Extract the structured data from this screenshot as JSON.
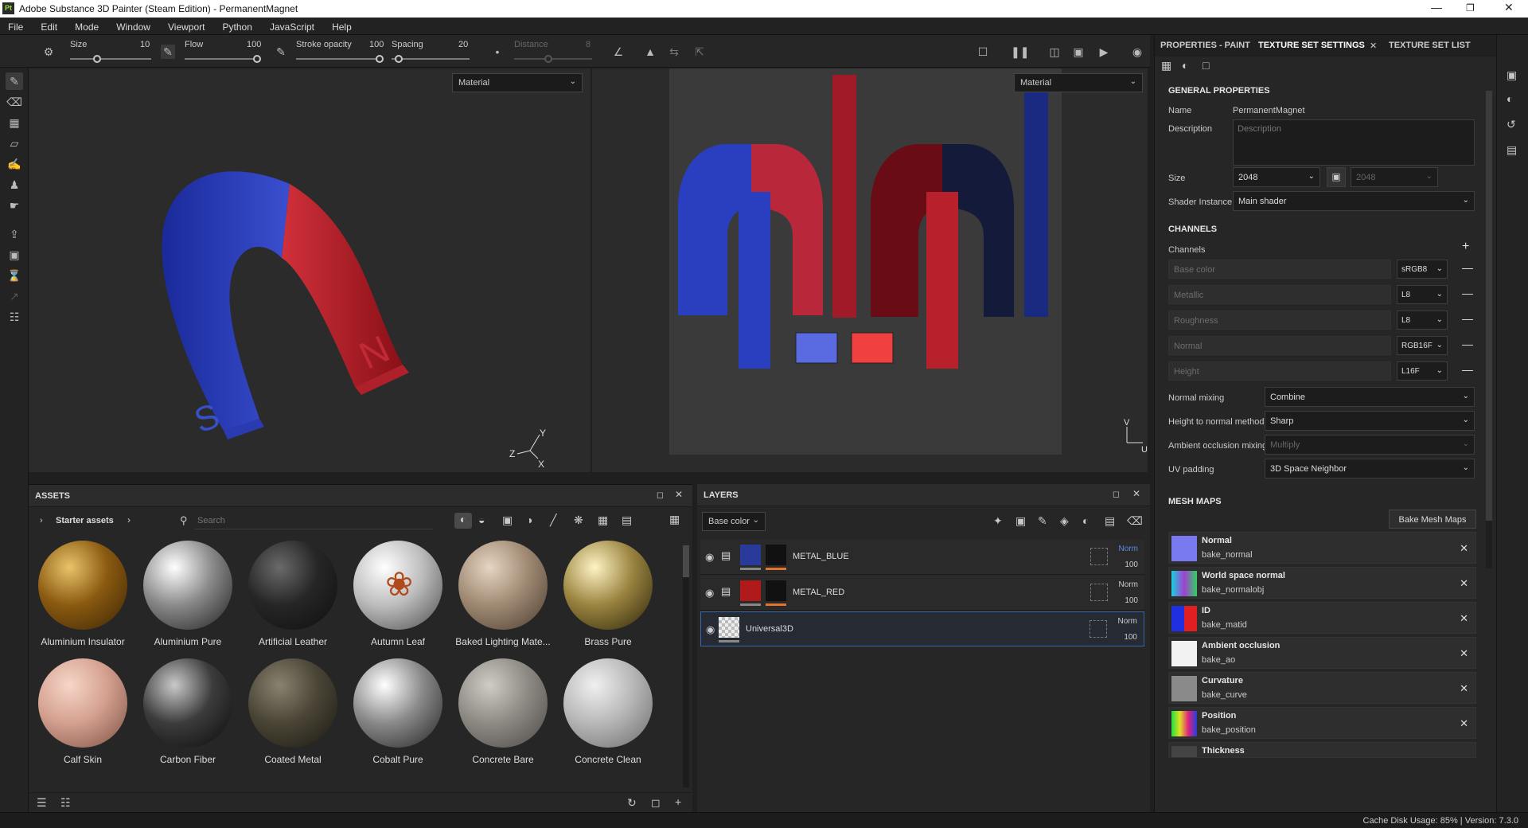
{
  "window": {
    "title": "Adobe Substance 3D Painter (Steam Edition) - PermanentMagnet",
    "app_icon": "Pt"
  },
  "menu": [
    "File",
    "Edit",
    "Mode",
    "Window",
    "Viewport",
    "Python",
    "JavaScript",
    "Help"
  ],
  "toolbar": {
    "size_label": "Size",
    "size_value": "10",
    "flow_label": "Flow",
    "flow_value": "100",
    "stroke_label": "Stroke opacity",
    "stroke_value": "100",
    "spacing_label": "Spacing",
    "spacing_value": "20",
    "distance_label": "Distance",
    "distance_value": "8"
  },
  "viewport3d": {
    "mode": "Material",
    "axis_y": "Y",
    "axis_z": "Z",
    "axis_x": "X",
    "letter_s": "S",
    "letter_n": "N"
  },
  "viewport2d": {
    "mode": "Material",
    "axis_y": "V",
    "axis_x": "U"
  },
  "assets": {
    "title": "ASSETS",
    "breadcrumb": "Starter assets",
    "search_placeholder": "Search",
    "items": [
      {
        "name": "Aluminium Insulator",
        "c1": "#e9c36a",
        "c2": "#8a5a10",
        "c3": "#3a2405"
      },
      {
        "name": "Aluminium Pure",
        "c1": "#ffffff",
        "c2": "#8a8a8a",
        "c3": "#1e1e1e"
      },
      {
        "name": "Artificial Leather",
        "c1": "#6a6a6a",
        "c2": "#262626",
        "c3": "#0e0e0e"
      },
      {
        "name": "Autumn Leaf",
        "c1": "#ffffff",
        "c2": "#bdbdbd",
        "c3": "#4a4a4a"
      },
      {
        "name": "Baked Lighting Mate...",
        "c1": "#e6d5c2",
        "c2": "#a08a74",
        "c3": "#4a3b2e"
      },
      {
        "name": "Brass Pure",
        "c1": "#fff3c4",
        "c2": "#9a8440",
        "c3": "#2a2208"
      },
      {
        "name": "Calf Skin",
        "c1": "#f6d6c8",
        "c2": "#d4a090",
        "c3": "#7a5040"
      },
      {
        "name": "Carbon Fiber",
        "c1": "#c9c9c9",
        "c2": "#3c3c3c",
        "c3": "#0a0a0a"
      },
      {
        "name": "Coated Metal",
        "c1": "#8a8270",
        "c2": "#4a4536",
        "c3": "#1a1812"
      },
      {
        "name": "Cobalt Pure",
        "c1": "#ffffff",
        "c2": "#8a8a8a",
        "c3": "#222222"
      },
      {
        "name": "Concrete Bare",
        "c1": "#cfccc6",
        "c2": "#8e8a84",
        "c3": "#4a4844"
      },
      {
        "name": "Concrete Clean",
        "c1": "#f0f0f0",
        "c2": "#b8b8b8",
        "c3": "#6a6a6a"
      }
    ]
  },
  "layers": {
    "title": "LAYERS",
    "channel": "Base color",
    "rows": [
      {
        "name": "METAL_BLUE",
        "blend": "Norm",
        "opacity": "100",
        "color": "#2a3a9a"
      },
      {
        "name": "METAL_RED",
        "blend": "Norm",
        "opacity": "100",
        "color": "#b01a1a"
      },
      {
        "name": "Universal3D",
        "blend": "Norm",
        "opacity": "100",
        "color": "#cccccc"
      }
    ]
  },
  "right": {
    "tabs": [
      "PROPERTIES - PAINT",
      "TEXTURE SET SETTINGS",
      "TEXTURE SET LIST"
    ],
    "general": "GENERAL PROPERTIES",
    "name_label": "Name",
    "name_value": "PermanentMagnet",
    "desc_label": "Description",
    "desc_placeholder": "Description",
    "size_label": "Size",
    "size_value": "2048",
    "size_value2": "2048",
    "shader_label": "Shader Instance",
    "shader_value": "Main shader",
    "channels_title": "CHANNELS",
    "channels_label": "Channels",
    "channels": [
      {
        "name": "Base color",
        "fmt": "sRGB8"
      },
      {
        "name": "Metallic",
        "fmt": "L8"
      },
      {
        "name": "Roughness",
        "fmt": "L8"
      },
      {
        "name": "Normal",
        "fmt": "RGB16F"
      },
      {
        "name": "Height",
        "fmt": "L16F"
      }
    ],
    "normal_mixing_label": "Normal mixing",
    "normal_mixing": "Combine",
    "htn_label": "Height to normal method",
    "htn": "Sharp",
    "ao_label": "Ambient occlusion mixing",
    "ao": "Multiply",
    "uv_label": "UV padding",
    "uv": "3D Space Neighbor",
    "mesh_title": "MESH MAPS",
    "bake_button": "Bake Mesh Maps",
    "mesh_maps": [
      {
        "name": "Normal",
        "file": "bake_normal"
      },
      {
        "name": "World space normal",
        "file": "bake_normalobj"
      },
      {
        "name": "ID",
        "file": "bake_matid"
      },
      {
        "name": "Ambient occlusion",
        "file": "bake_ao"
      },
      {
        "name": "Curvature",
        "file": "bake_curve"
      },
      {
        "name": "Position",
        "file": "bake_position"
      },
      {
        "name": "Thickness",
        "file": ""
      }
    ]
  },
  "status": "Cache Disk Usage:   85% | Version: 7.3.0"
}
